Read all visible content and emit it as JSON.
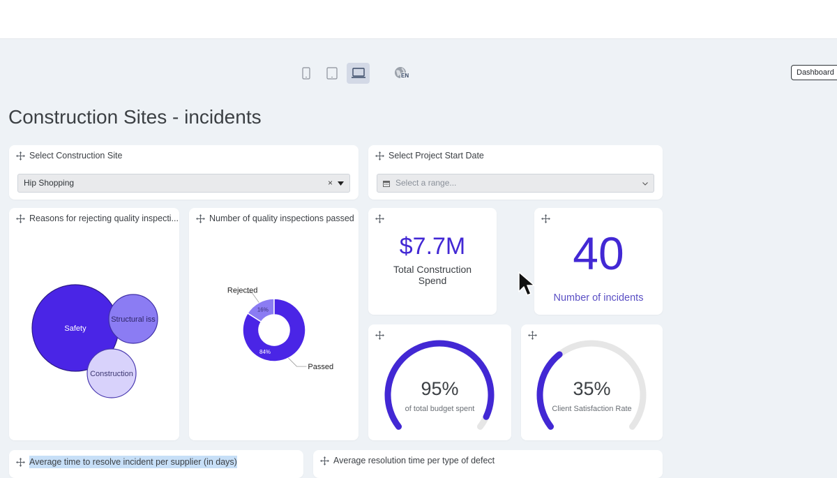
{
  "toolbar": {
    "devices": [
      {
        "name": "mobile",
        "icon": "phone-icon",
        "active": false
      },
      {
        "name": "tablet",
        "icon": "tablet-icon",
        "active": false
      },
      {
        "name": "desktop",
        "icon": "laptop-icon",
        "active": true
      }
    ],
    "language_badge": "EN",
    "dashboard_button": "Dashboard"
  },
  "page": {
    "title": "Construction Sites - incidents"
  },
  "filters": {
    "site": {
      "label": "Select Construction Site",
      "value": "Hip Shopping",
      "clear_glyph": "×"
    },
    "date": {
      "label": "Select Project Start Date",
      "placeholder": "Select a range..."
    }
  },
  "widgets": {
    "reasons": {
      "title": "Reasons for rejecting quality inspecti..."
    },
    "inspections": {
      "title": "Number of quality inspections passed"
    },
    "spend": {
      "value": "$7.7M",
      "label_line1": "Total Construction",
      "label_line2": "Spend"
    },
    "incidents": {
      "value": "40",
      "label": "Number of incidents"
    },
    "budget": {
      "value": "95%",
      "label": "of total budget spent",
      "fraction": 0.95
    },
    "satisfaction": {
      "value": "35%",
      "label": "Client Satisfaction Rate",
      "fraction": 0.35
    },
    "avg_supplier": {
      "title": "Average time to resolve incident per supplier (in days)"
    },
    "avg_defect": {
      "title": "Average resolution time per type of defect"
    }
  },
  "chart_data": [
    {
      "type": "bubble",
      "labels": [
        "Safety",
        "Structural iss",
        "Construction"
      ],
      "relative_size": [
        1.0,
        0.31,
        0.23
      ],
      "colors": [
        "#4a25e6",
        "#8b7cf3",
        "#d8d2fb"
      ]
    },
    {
      "type": "pie",
      "subtype": "donut",
      "labels": [
        "Rejected",
        "Passed"
      ],
      "values": [
        16,
        84
      ],
      "value_labels": [
        "16%",
        "84%"
      ],
      "colors": [
        "#8b7cf3",
        "#4a25e6"
      ]
    }
  ],
  "colors": {
    "accent": "#4228d4",
    "gauge_track": "#e6e6e6",
    "background": "#eef2f6"
  }
}
